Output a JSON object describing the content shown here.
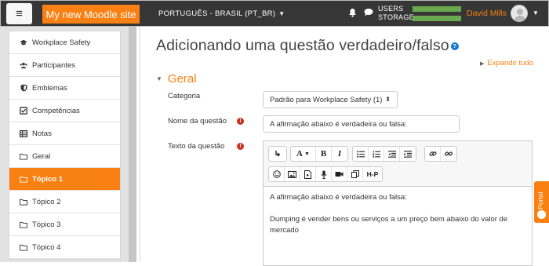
{
  "navbar": {
    "menu_glyph": "≡",
    "site_name": "My new Moodle site",
    "language": "PORTUGUÊS - BRASIL (PT_BR)",
    "storage_label_1": "USERS",
    "storage_label_2": "STORAGE",
    "users_fill": 1.0,
    "storage_fill": 1.0,
    "user_name": "David Mills"
  },
  "sidebar": {
    "items": [
      {
        "label": "Workplace Safety",
        "icon": "graduation-cap-icon"
      },
      {
        "label": "Participantes",
        "icon": "users-icon"
      },
      {
        "label": "Emblemas",
        "icon": "shield-icon"
      },
      {
        "label": "Competências",
        "icon": "checkbox-icon"
      },
      {
        "label": "Notas",
        "icon": "table-icon"
      },
      {
        "label": "Geral",
        "icon": "folder-icon"
      },
      {
        "label": "Tópico 1",
        "icon": "folder-icon",
        "active": true
      },
      {
        "label": "Tópico 2",
        "icon": "folder-icon"
      },
      {
        "label": "Tópico 3",
        "icon": "folder-icon"
      },
      {
        "label": "Tópico 4",
        "icon": "folder-icon"
      }
    ]
  },
  "main": {
    "title": "Adicionando uma questão verdadeiro/falso",
    "help_glyph": "?",
    "expand_all": "Expandir tudo",
    "section": "Geral",
    "category_label": "Categoria",
    "category_value": "Padrão para Workplace Safety (1)",
    "question_name_label": "Nome da questão",
    "question_name_value": "A afirmação abaixo é verdadeira ou falsa:",
    "question_text_label": "Texto da questão",
    "required_glyph": "!",
    "editor_line_1": "A afirmação abaixo é verdadeira ou falsa:",
    "editor_line_2": "Dumping é vender bens ou serviços a um preço bem abaixo do valor de mercado"
  },
  "toolbar": {
    "bold": "B",
    "italic": "I",
    "font_a": "A",
    "h5p": "H-P"
  },
  "portal_tab": {
    "label": "Portal"
  },
  "colors": {
    "brand_orange": "#f98012",
    "navbar": "#363636",
    "required": "#ca3120",
    "help": "#1177d1"
  }
}
